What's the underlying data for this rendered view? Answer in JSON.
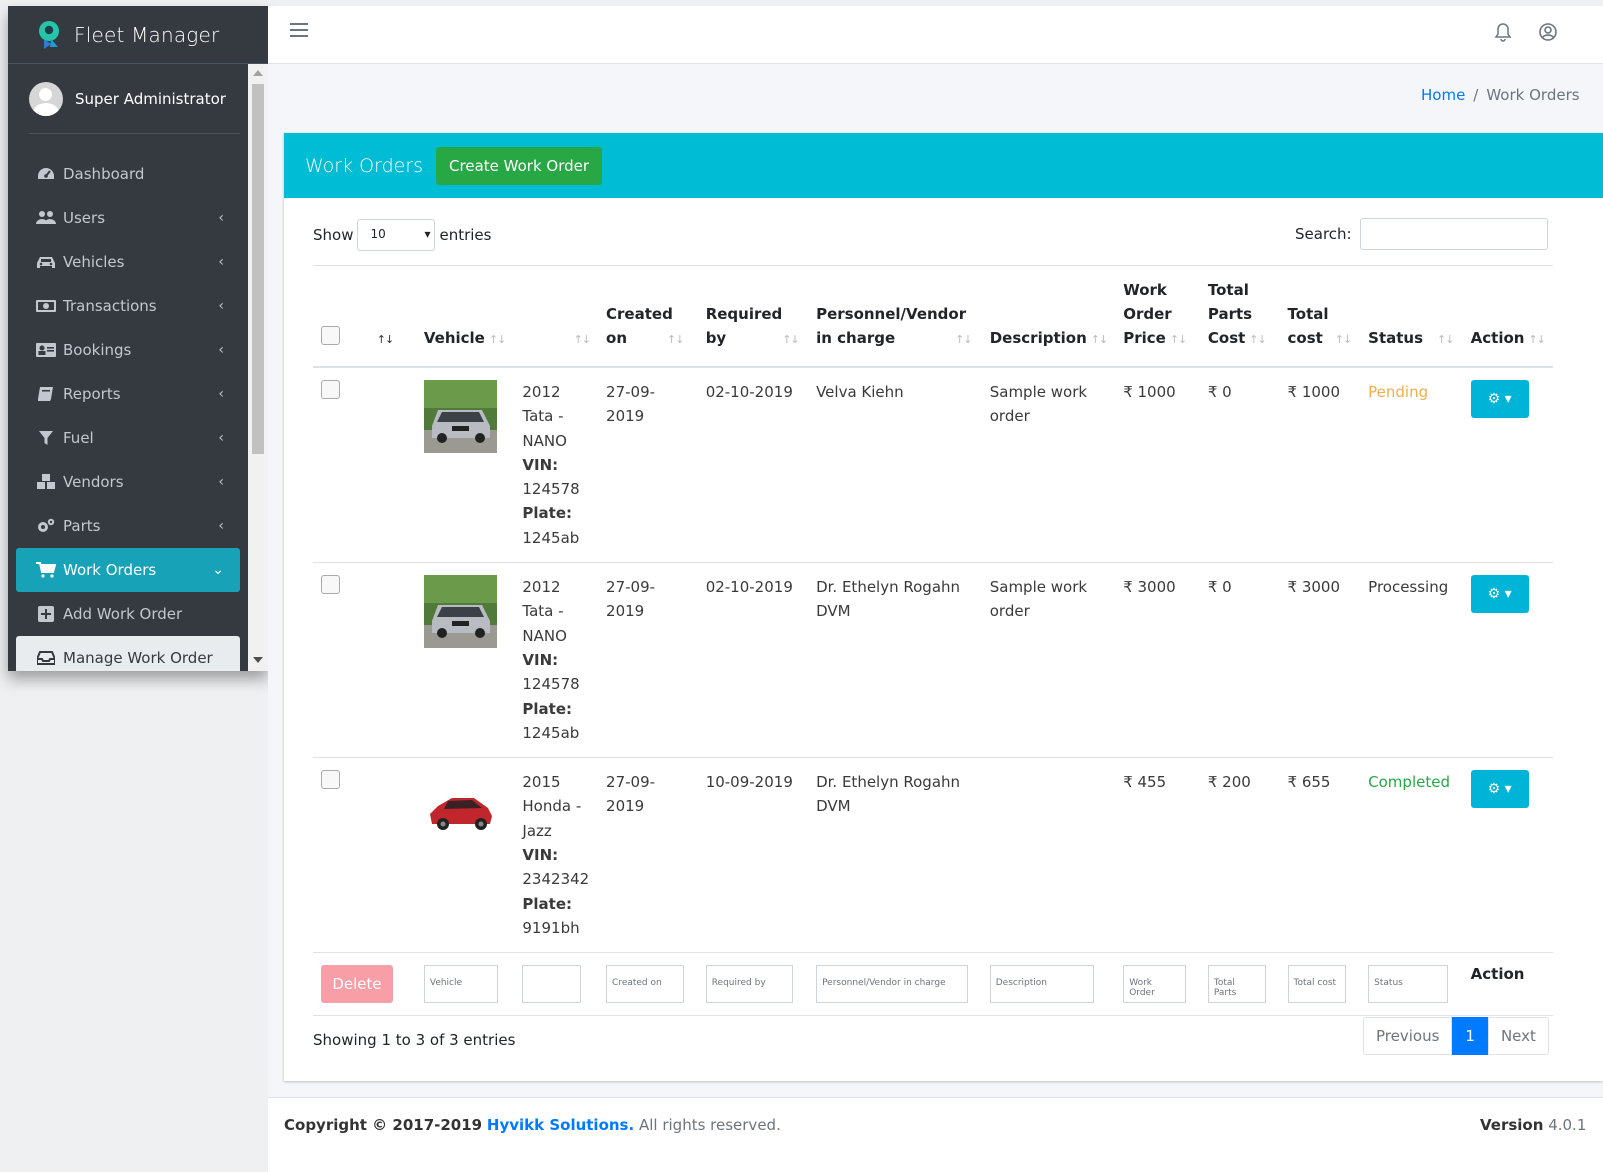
{
  "app": {
    "title": "Fleet Manager"
  },
  "user": {
    "name": "Super Administrator"
  },
  "sidebar": {
    "items": [
      {
        "label": "Dashboard",
        "icon": "dashboard-icon"
      },
      {
        "label": "Users",
        "icon": "users-icon"
      },
      {
        "label": "Vehicles",
        "icon": "car-icon"
      },
      {
        "label": "Transactions",
        "icon": "money-icon"
      },
      {
        "label": "Bookings",
        "icon": "address-card-icon"
      },
      {
        "label": "Reports",
        "icon": "book-icon"
      },
      {
        "label": "Fuel",
        "icon": "filter-icon"
      },
      {
        "label": "Vendors",
        "icon": "cubes-icon"
      },
      {
        "label": "Parts",
        "icon": "gears-icon"
      },
      {
        "label": "Work Orders",
        "icon": "cart-icon"
      },
      {
        "label": "Add Work Order",
        "icon": "plus-square-icon"
      },
      {
        "label": "Manage Work Order",
        "icon": "inbox-icon"
      }
    ]
  },
  "breadcrumb": {
    "home": "Home",
    "separator": "/",
    "current": "Work Orders"
  },
  "card": {
    "title": "Work Orders",
    "create_label": "Create Work Order",
    "show_label": "Show",
    "entries_value": "10",
    "entries_label": "entries",
    "search_label": "Search:"
  },
  "table": {
    "headers": {
      "vehicle": "Vehicle",
      "created_1": "Created",
      "created_2": "on",
      "required_1": "Required",
      "required_2": "by",
      "personnel_1": "Personnel/Vendor",
      "personnel_2": "in charge",
      "description": "Description",
      "wo_1": "Work",
      "wo_2": "Order",
      "wo_3": "Price",
      "parts_1": "Total",
      "parts_2": "Parts",
      "parts_3": "Cost",
      "total_1": "Total",
      "total_2": "cost",
      "status": "Status",
      "action": "Action"
    },
    "vin_label": "VIN:",
    "plate_label": "Plate:",
    "rows": [
      {
        "vehicle_l1": "2012",
        "vehicle_l2": "Tata -",
        "vehicle_l3": "NANO",
        "vin": "124578",
        "plate": "1245ab",
        "created": "27-09-2019",
        "required": "02-10-2019",
        "personnel": "Velva Kiehn",
        "description": "Sample work order",
        "wo_price": "₹ 1000",
        "parts_cost": "₹ 0",
        "total_cost": "₹ 1000",
        "status": "Pending"
      },
      {
        "vehicle_l1": "2012",
        "vehicle_l2": "Tata -",
        "vehicle_l3": "NANO",
        "vin": "124578",
        "plate": "1245ab",
        "created": "27-09-2019",
        "required": "02-10-2019",
        "personnel": "Dr. Ethelyn Rogahn DVM",
        "description": "Sample work order",
        "wo_price": "₹ 3000",
        "parts_cost": "₹ 0",
        "total_cost": "₹ 3000",
        "status": "Processing"
      },
      {
        "vehicle_l1": "2015",
        "vehicle_l2": "Honda -",
        "vehicle_l3": "Jazz",
        "vin": "2342342",
        "plate": "9191bh",
        "created": "27-09-2019",
        "required": "10-09-2019",
        "personnel": "Dr. Ethelyn Rogahn DVM",
        "description": "",
        "wo_price": "₹ 455",
        "parts_cost": "₹ 200",
        "total_cost": "₹ 655",
        "status": "Completed"
      }
    ],
    "footer": {
      "delete_label": "Delete",
      "vehicle_ph": "Vehicle",
      "created_ph": "Created on",
      "required_ph": "Required by",
      "personnel_ph": "Personnel/Vendor in charge",
      "description_ph": "Description",
      "wo_ph": "Work Order",
      "parts_ph": "Total Parts",
      "total_ph": "Total cost",
      "status_ph": "Status",
      "action_label": "Action"
    }
  },
  "pagination": {
    "info": "Showing 1 to 3 of 3 entries",
    "previous": "Previous",
    "current": "1",
    "next": "Next"
  },
  "footer": {
    "copyright": "Copyright © 2017-2019",
    "company": "Hyvikk Solutions.",
    "rights": "All rights reserved.",
    "version_label": "Version",
    "version": "4.0.1"
  },
  "colors": {
    "sidebar": "#343a40",
    "card_header": "#00bcd4",
    "create_button": "#28a745",
    "active_nav": "#17a2b8",
    "action_button": "#00b4d8",
    "pending": "#f0ad4e",
    "completed": "#28a745"
  }
}
